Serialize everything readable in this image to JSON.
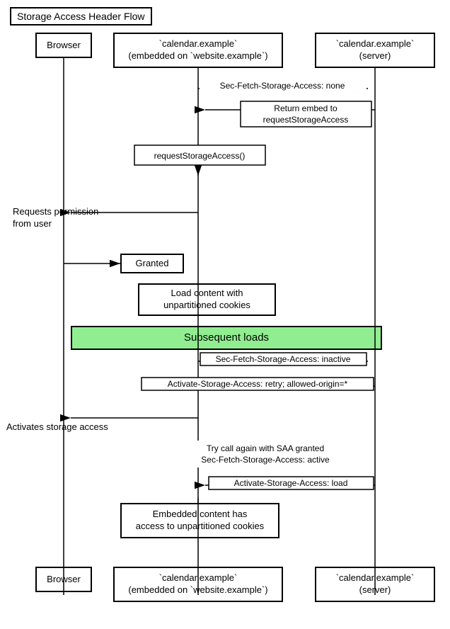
{
  "title": "Storage Access Header Flow",
  "boxes": {
    "browser_top": {
      "label": "Browser"
    },
    "embed_top": {
      "label": "`calendar.example`\n(embedded on `website.example`)"
    },
    "server_top": {
      "label": "`calendar.example`\n(server)"
    },
    "request_permission": {
      "label": "Requests permission\nfrom user"
    },
    "granted": {
      "label": "Granted"
    },
    "load_content": {
      "label": "Load content with\nunpartitioned cookies"
    },
    "subsequent_loads": {
      "label": "Subsequent loads"
    },
    "activates_storage": {
      "label": "Activates storage access"
    },
    "embedded_content": {
      "label": "Embedded content has\naccess to unpartitioned cookies"
    },
    "browser_bottom": {
      "label": "Browser"
    },
    "embed_bottom": {
      "label": "`calendar.example`\n(embedded on `website.example`)"
    },
    "server_bottom": {
      "label": "`calendar.example`\n(server)"
    }
  },
  "arrows": {
    "sec_fetch_none": "Sec-Fetch-Storage-Access: none",
    "return_embed": "Return embed to\nrequestStorageAccess",
    "request_storage_access": "requestStorageAccess()",
    "sec_fetch_inactive": "Sec-Fetch-Storage-Access: inactive",
    "activate_retry": "Activate-Storage-Access: retry; allowed-origin=*",
    "try_call_again": "Try call again with SAA granted\nSec-Fetch-Storage-Access: active",
    "activate_load": "Activate-Storage-Access: load"
  }
}
